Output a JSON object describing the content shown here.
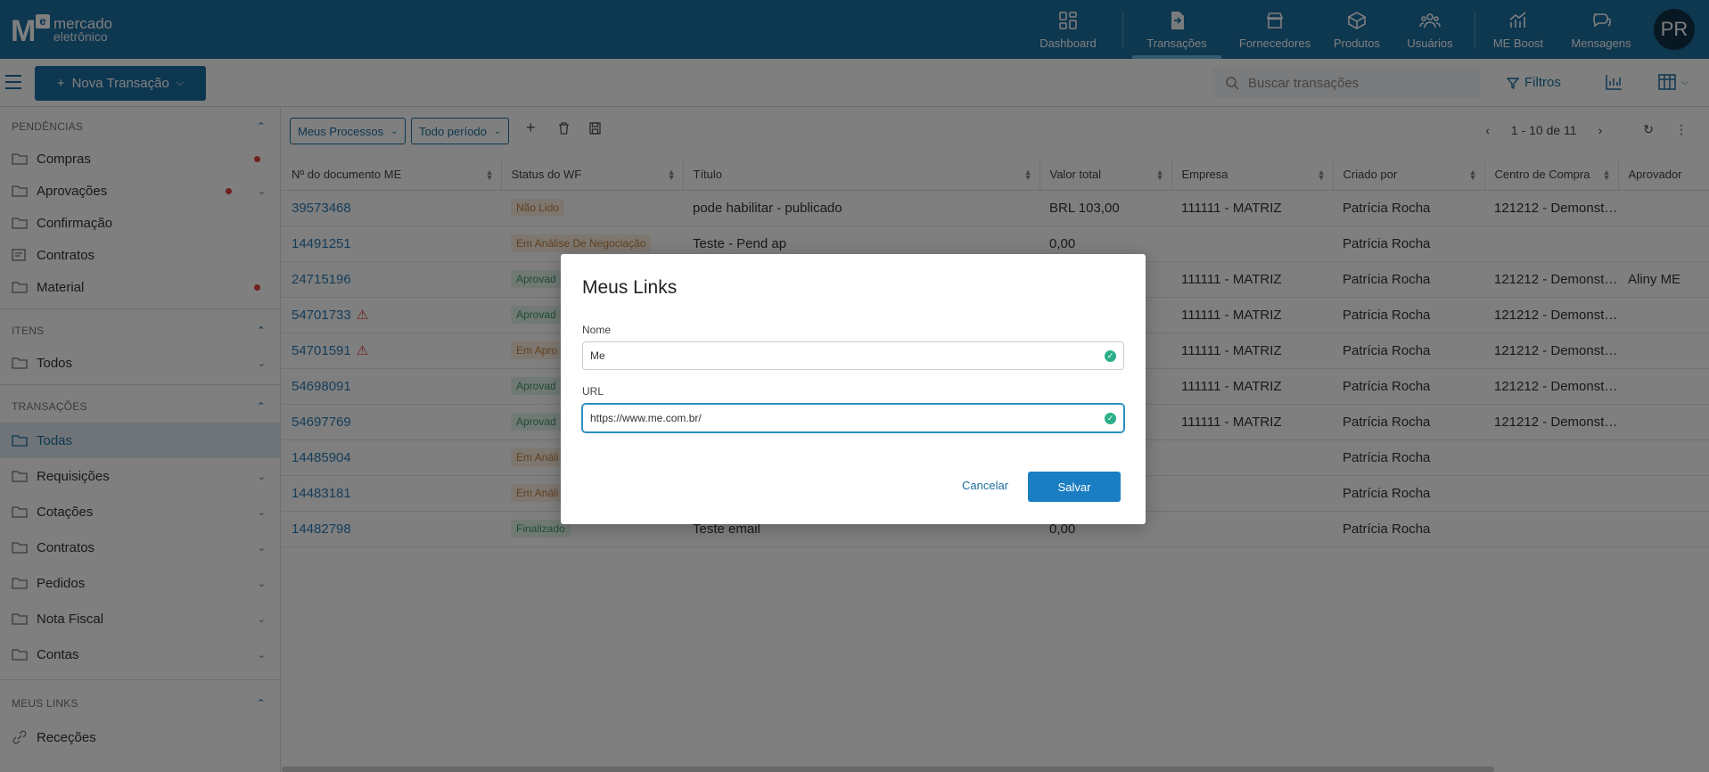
{
  "brand": {
    "line1": "mercado",
    "line2": "eletrônico"
  },
  "nav": [
    {
      "label": "Dashboard",
      "icon": "dashboard-icon"
    },
    {
      "label": "Transações",
      "icon": "transactions-icon",
      "active": true
    },
    {
      "label": "Fornecedores",
      "icon": "store-icon"
    },
    {
      "label": "Produtos",
      "icon": "box-icon"
    },
    {
      "label": "Usuários",
      "icon": "users-icon"
    },
    {
      "label": "ME Boost",
      "icon": "chart-up-icon"
    },
    {
      "label": "Mensagens",
      "icon": "chat-icon"
    }
  ],
  "user": {
    "initials": "PR"
  },
  "subbar": {
    "new_button": "Nova Transação",
    "search_placeholder": "Buscar transações",
    "filters": "Filtros"
  },
  "sidebar": {
    "pendencias": {
      "title": "PENDÊNCIAS",
      "items": [
        "Compras",
        "Aprovações",
        "Confirmação",
        "Contratos",
        "Material"
      ]
    },
    "itens": {
      "title": "ITENS",
      "items": [
        "Todos"
      ]
    },
    "transacoes": {
      "title": "TRANSAÇÕES",
      "items": [
        "Todas",
        "Requisições",
        "Cotações",
        "Contratos",
        "Pedidos",
        "Nota Fiscal",
        "Contas"
      ]
    },
    "links": {
      "title": "MEUS LINKS",
      "items": [
        "Receções"
      ]
    }
  },
  "toolbar": {
    "process_filter": "Meus Processos",
    "period_filter": "Todo período",
    "pagination": "1 - 10 de 11"
  },
  "table": {
    "headers": [
      "Nº do documento ME",
      "Status do WF",
      "Título",
      "Valor total",
      "Empresa",
      "Criado por",
      "Centro de Compra",
      "Aprovador"
    ],
    "rows": [
      {
        "doc": "39573468",
        "status": "Não Lido",
        "status_color": "orange",
        "title": "pode habilitar - publicado",
        "value": "BRL 103,00",
        "company": "111111 - MATRIZ",
        "creator": "Patrícia Rocha",
        "center": "121212 - Demonstr...",
        "approver": ""
      },
      {
        "doc": "14491251",
        "status": "Em Análise De Negociação",
        "status_color": "orange",
        "title": "Teste - Pend ap",
        "value": "0,00",
        "company": "",
        "creator": "Patrícia Rocha",
        "center": "",
        "approver": ""
      },
      {
        "doc": "24715196",
        "status": "Aprovad",
        "status_color": "green",
        "title": "",
        "value": "",
        "company": "111111 - MATRIZ",
        "creator": "Patrícia Rocha",
        "center": "121212 - Demonstr...",
        "approver": "Aliny ME"
      },
      {
        "doc": "54701733",
        "status": "Aprovad",
        "status_color": "green",
        "title": "",
        "value": "",
        "company": "111111 - MATRIZ",
        "creator": "Patrícia Rocha",
        "center": "121212 - Demonstr...",
        "approver": "",
        "warn": true
      },
      {
        "doc": "54701591",
        "status": "Em Apro",
        "status_color": "orange",
        "title": "",
        "value": "",
        "company": "111111 - MATRIZ",
        "creator": "Patrícia Rocha",
        "center": "121212 - Demonstr...",
        "approver": "",
        "warn": true
      },
      {
        "doc": "54698091",
        "status": "Aprovad",
        "status_color": "green",
        "title": "",
        "value": "",
        "company": "111111 - MATRIZ",
        "creator": "Patrícia Rocha",
        "center": "121212 - Demonstr...",
        "approver": ""
      },
      {
        "doc": "54697769",
        "status": "Aprovad",
        "status_color": "green",
        "title": "",
        "value": "",
        "company": "111111 - MATRIZ",
        "creator": "Patrícia Rocha",
        "center": "121212 - Demonstr...",
        "approver": ""
      },
      {
        "doc": "14485904",
        "status": "Em Análi",
        "status_color": "orange",
        "title": "",
        "value": "",
        "company": "",
        "creator": "Patrícia Rocha",
        "center": "",
        "approver": ""
      },
      {
        "doc": "14483181",
        "status": "Em Análi",
        "status_color": "orange",
        "title": "",
        "value": "",
        "company": "",
        "creator": "Patrícia Rocha",
        "center": "",
        "approver": ""
      },
      {
        "doc": "14482798",
        "status": "Finalizado",
        "status_color": "green",
        "title": "Teste email",
        "value": "0,00",
        "company": "",
        "creator": "Patrícia Rocha",
        "center": "",
        "approver": ""
      }
    ]
  },
  "modal": {
    "title": "Meus Links",
    "name_label": "Nome",
    "name_value": "Me",
    "url_label": "URL",
    "url_value": "https://www.me.com.br/",
    "cancel": "Cancelar",
    "save": "Salvar"
  },
  "colors": {
    "primary": "#1d6fa0",
    "alert": "#e0403a",
    "success": "#2bb08a"
  }
}
